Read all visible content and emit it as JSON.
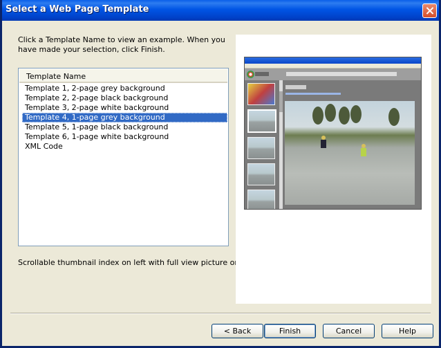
{
  "window": {
    "title": "Select a Web Page Template"
  },
  "instructions": "Click a Template Name to view an example. When you have made your selection, click Finish.",
  "list": {
    "header": "Template Name",
    "items": [
      "Template 1, 2-page grey background",
      "Template 2, 2-page black background",
      "Template 3, 2-page white background",
      "Template 4, 1-page grey background",
      "Template 5, 1-page black background",
      "Template 6, 1-page white background",
      "XML Code"
    ],
    "selected_index": 3
  },
  "description": "Scrollable thumbnail index on left with full view picture on right.",
  "buttons": {
    "back": "< Back",
    "finish": "Finish",
    "cancel": "Cancel",
    "help": "Help"
  },
  "colors": {
    "selection": "#316ac5",
    "titlebar": "#0055e5"
  }
}
